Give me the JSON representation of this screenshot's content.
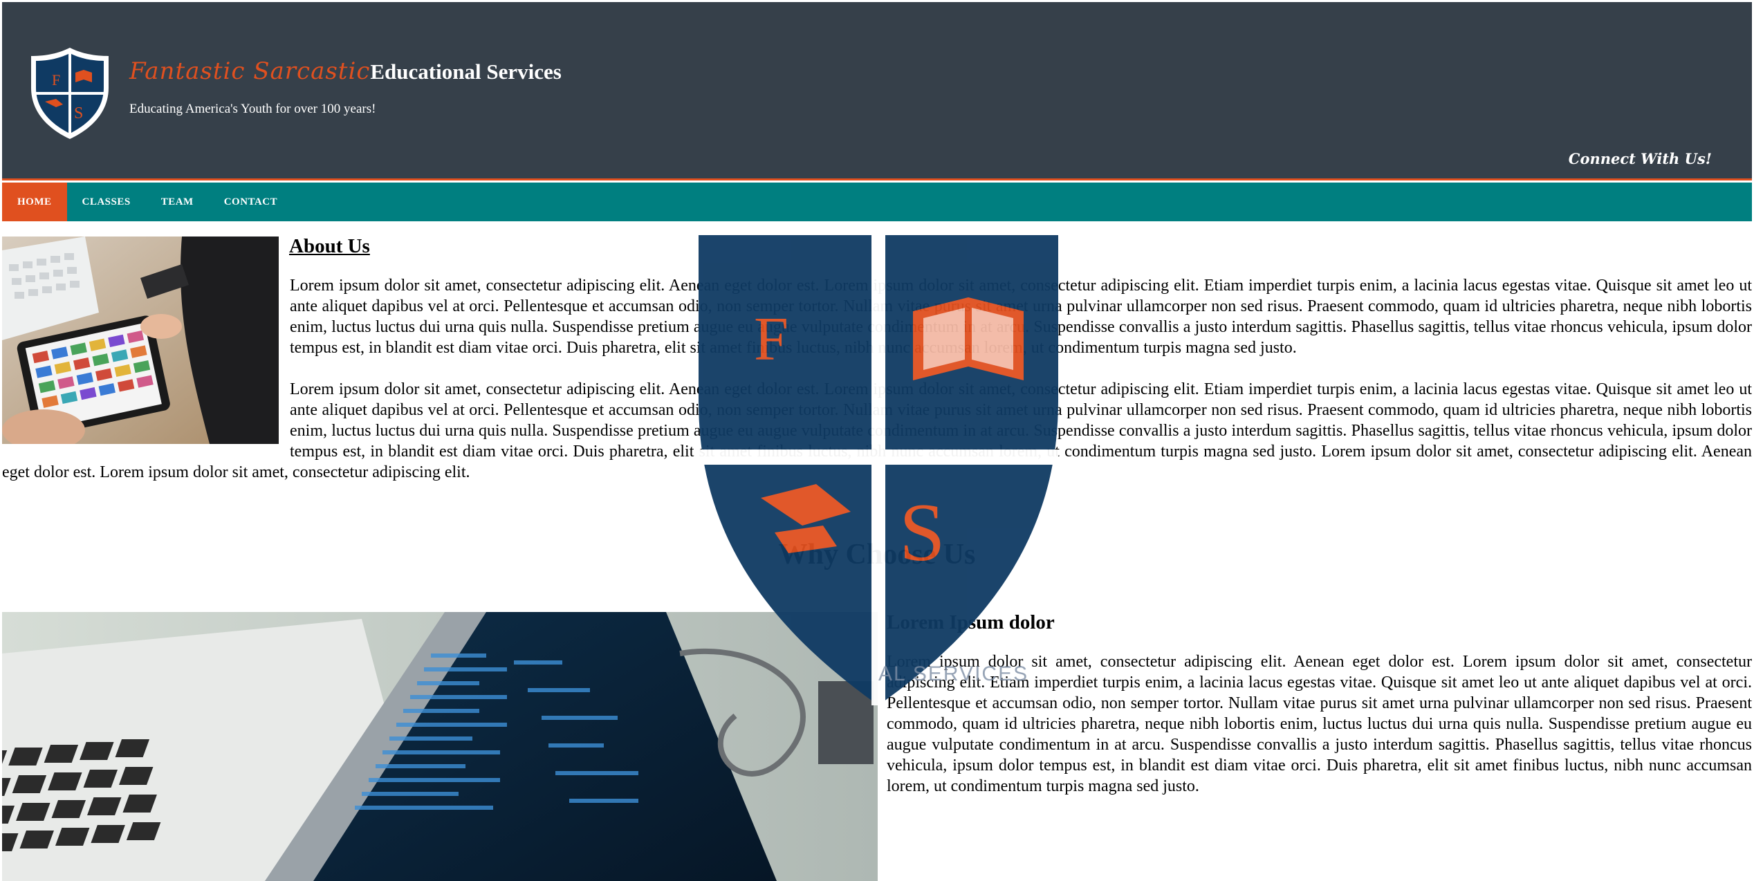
{
  "header": {
    "brand_script": "Fantastic Sarcastic",
    "brand_plain": "Educational Services",
    "tagline": "Educating America's Youth for over 100 years!",
    "connect": "Connect With Us!"
  },
  "logo": {
    "letters": [
      "F",
      "S"
    ],
    "colors": {
      "navy": "#0f3a63",
      "orange": "#e0501f"
    }
  },
  "nav": {
    "items": [
      {
        "label": "HOME",
        "active": true
      },
      {
        "label": "CLASSES",
        "active": false
      },
      {
        "label": "TEAM",
        "active": false
      },
      {
        "label": "CONTACT",
        "active": false
      }
    ]
  },
  "about": {
    "title": "About Us",
    "paragraphs": [
      "Lorem ipsum dolor sit amet, consectetur adipiscing elit. Aenean eget dolor est. Lorem ipsum dolor sit amet, consectetur adipiscing elit. Etiam imperdiet turpis enim, a lacinia lacus egestas vitae. Quisque sit amet leo ut ante aliquet dapibus vel at orci. Pellentesque et accumsan odio, non semper tortor. Nullam vitae purus sit amet urna pulvinar ullamcorper non sed risus. Praesent commodo, quam id ultricies pharetra, neque nibh lobortis enim, luctus luctus dui urna quis nulla. Suspendisse pretium augue eu augue vulputate condimentum in at arcu. Suspendisse convallis a justo interdum sagittis. Phasellus sagittis, tellus vitae rhoncus vehicula, ipsum dolor tempus est, in blandit est diam vitae orci. Duis pharetra, elit sit amet finibus luctus, nibh nunc accumsan lorem, ut condimentum turpis magna sed justo.",
      "Lorem ipsum dolor sit amet, consectetur adipiscing elit. Aenean eget dolor est. Lorem ipsum dolor sit amet, consectetur adipiscing elit. Etiam imperdiet turpis enim, a lacinia lacus egestas vitae. Quisque sit amet leo ut ante aliquet dapibus vel at orci. Pellentesque et accumsan odio, non semper tortor. Nullam vitae purus sit amet urna pulvinar ullamcorper non sed risus. Praesent commodo, quam id ultricies pharetra, neque nibh lobortis enim, luctus luctus dui urna quis nulla. Suspendisse pretium augue eu augue vulputate condimentum in at arcu. Suspendisse convallis a justo interdum sagittis. Phasellus sagittis, tellus vitae rhoncus vehicula, ipsum dolor tempus est, in blandit est diam vitae orci. Duis pharetra, elit sit amet finibus luctus, nibh nunc accumsan lorem, ut condimentum turpis magna sed justo. Lorem ipsum dolor sit amet, consectetur adipiscing elit. Aenean eget dolor est. Lorem ipsum dolor sit amet, consectetur adipiscing elit."
    ]
  },
  "why": {
    "title": "Why Choose Us",
    "subtitle": "Lorem Ipsum dolor",
    "text": "Lorem ipsum dolor sit amet, consectetur adipiscing elit. Aenean eget dolor est. Lorem ipsum dolor sit amet, consectetur adipiscing elit. Etiam imperdiet turpis enim, a lacinia lacus egestas vitae. Quisque sit amet leo ut ante aliquet dapibus vel at orci. Pellentesque et accumsan odio, non semper tortor. Nullam vitae purus sit amet urna pulvinar ullamcorper non sed risus. Praesent commodo, quam id ultricies pharetra, neque nibh lobortis enim, luctus luctus dui urna quis nulla. Suspendisse pretium augue eu augue vulputate condimentum in at arcu. Suspendisse convallis a justo interdum sagittis. Phasellus sagittis, tellus vitae rhoncus vehicula, ipsum dolor tempus est, in blandit est diam vitae orci. Duis pharetra, elit sit amet finibus luctus, nibh nunc accumsan lorem, ut condimentum turpis magna sed justo."
  },
  "watermark": {
    "text": "AL SERVICES"
  },
  "colors": {
    "header_bg": "#36404a",
    "nav_bg": "#007f80",
    "accent": "#e0501f"
  }
}
